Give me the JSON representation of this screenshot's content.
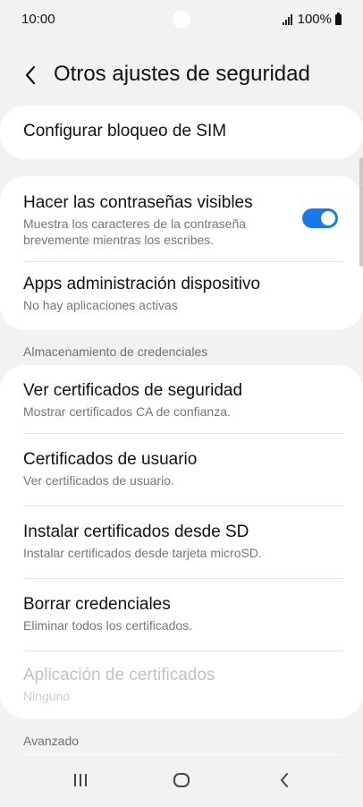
{
  "status_bar": {
    "time": "10:00",
    "battery": "100%",
    "icons": [
      "signal-icon",
      "battery-icon"
    ]
  },
  "header": {
    "title": "Otros ajustes de seguridad",
    "back_icon": "back-arrow-icon"
  },
  "sim_card": {
    "title": "Configurar bloqueo de SIM"
  },
  "passwords_card": {
    "items": [
      {
        "title": "Hacer las contraseñas visibles",
        "subtitle": "Muestra los caracteres de la contraseña brevemente mientras los escribes.",
        "toggle_on": true
      },
      {
        "title": "Apps administración dispositivo",
        "subtitle": "No hay aplicaciones activas"
      }
    ]
  },
  "credentials_section": {
    "label": "Almacenamiento de credenciales",
    "items": [
      {
        "title": "Ver certificados de seguridad",
        "subtitle": "Mostrar certificados CA de confianza."
      },
      {
        "title": "Certificados de usuario",
        "subtitle": "Ver certificados de usuario."
      },
      {
        "title": "Instalar certificados desde SD",
        "subtitle": "Instalar certificados desde tarjeta microSD."
      },
      {
        "title": "Borrar credenciales",
        "subtitle": "Eliminar todos los certificados."
      },
      {
        "title": "Aplicación de certificados",
        "subtitle": "Ninguno",
        "disabled": true
      }
    ]
  },
  "advanced_section": {
    "label": "Avanzado"
  },
  "colors": {
    "accent": "#1a79ea",
    "background": "#f2f2f2",
    "card": "#ffffff"
  },
  "nav_bar": {
    "icons": [
      "recent-apps-icon",
      "home-icon",
      "back-icon"
    ]
  }
}
